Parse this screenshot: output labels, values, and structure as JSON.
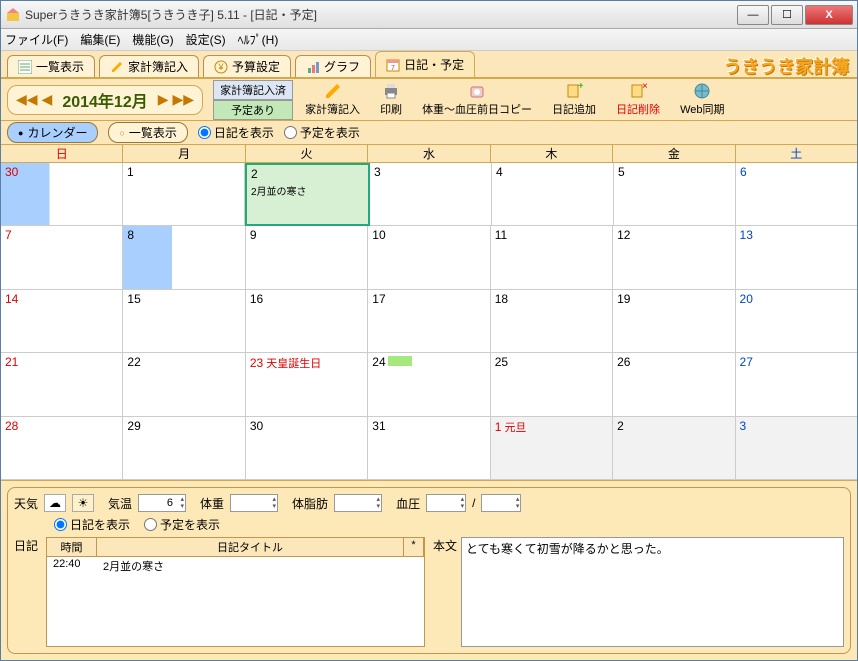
{
  "window": {
    "title": "Superうきうき家計簿5[うきうき子] 5.11 - [日記・予定]"
  },
  "menu": {
    "file": "ファイル(F)",
    "edit": "編集(E)",
    "func": "機能(G)",
    "settings": "設定(S)",
    "help": "ﾍﾙﾌﾟ(H)"
  },
  "tabs": {
    "list": "一覧表示",
    "entry": "家計簿記入",
    "budget": "予算設定",
    "graph": "グラフ",
    "diary": "日記・予定"
  },
  "logo": "うきうき家計簿",
  "nav": {
    "date": "2014年12月"
  },
  "status": {
    "entered": "家計簿記入済",
    "scheduled": "予定あり"
  },
  "toolbar": {
    "entry": "家計簿記入",
    "print": "印刷",
    "copy": "体重〜血圧前日コピー",
    "add": "日記追加",
    "delete": "日記削除",
    "sync": "Web同期"
  },
  "viewbar": {
    "calendar": "カレンダー",
    "list": "一覧表示",
    "show_diary": "日記を表示",
    "show_schedule": "予定を表示"
  },
  "weekdays": {
    "sun": "日",
    "mon": "月",
    "tue": "火",
    "wed": "水",
    "thu": "木",
    "fri": "金",
    "sat": "土"
  },
  "calendar": {
    "r0c0": "30",
    "r0c1": "1",
    "r0c2": "2",
    "r0c2_note": "2月並の寒さ",
    "r0c3": "3",
    "r0c4": "4",
    "r0c5": "5",
    "r0c6": "6",
    "r1c0": "7",
    "r1c1": "8",
    "r1c2": "9",
    "r1c3": "10",
    "r1c4": "11",
    "r1c5": "12",
    "r1c6": "13",
    "r2c0": "14",
    "r2c1": "15",
    "r2c2": "16",
    "r2c3": "17",
    "r2c4": "18",
    "r2c5": "19",
    "r2c6": "20",
    "r3c0": "21",
    "r3c1": "22",
    "r3c2": "23",
    "r3c2_hol": "天皇誕生日",
    "r3c3": "24",
    "r3c4": "25",
    "r3c5": "26",
    "r3c6": "27",
    "r4c0": "28",
    "r4c1": "29",
    "r4c2": "30",
    "r4c3": "31",
    "r4c4": "1",
    "r4c4_hol": "元旦",
    "r4c5": "2",
    "r4c6": "3"
  },
  "measure": {
    "weather": "天気",
    "temp": "気温",
    "temp_val": "6",
    "weight": "体重",
    "fat": "体脂肪",
    "bp": "血圧",
    "slash": "/"
  },
  "diary": {
    "label": "日記",
    "th_time": "時間",
    "th_title": "日記タイトル",
    "th_star": "*",
    "row_time": "22:40",
    "row_title": "2月並の寒さ",
    "body_label": "本文",
    "body_text": "とても寒くて初雪が降るかと思った。",
    "radio_diary": "日記を表示",
    "radio_schedule": "予定を表示"
  }
}
